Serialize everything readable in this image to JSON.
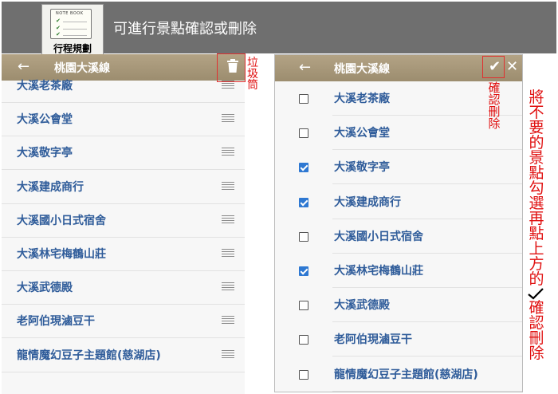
{
  "banner": {
    "notebook_label": "NOTE BOOK",
    "icon_caption": "行程規劃",
    "title": "可進行景點確認或刪除"
  },
  "left_panel": {
    "back_icon": "arrow-left-icon",
    "title": "桃園大溪線",
    "trash_icon": "trash-icon",
    "items": [
      {
        "label": "大溪老茶廠"
      },
      {
        "label": "大溪公會堂"
      },
      {
        "label": "大溪敬字亭"
      },
      {
        "label": "大溪建成商行"
      },
      {
        "label": "大溪國小日式宿舍"
      },
      {
        "label": "大溪林宅梅鶴山莊"
      },
      {
        "label": "大溪武德殿"
      },
      {
        "label": "老阿伯現滷豆干"
      },
      {
        "label": "龍情魔幻豆子主題館(慈湖店)"
      }
    ]
  },
  "right_panel": {
    "back_icon": "arrow-left-icon",
    "title": "桃園大溪線",
    "confirm_icon": "check-icon",
    "close_icon": "close-icon",
    "items": [
      {
        "label": "大溪老茶廠",
        "checked": false
      },
      {
        "label": "大溪公會堂",
        "checked": false
      },
      {
        "label": "大溪敬字亭",
        "checked": true
      },
      {
        "label": "大溪建成商行",
        "checked": true
      },
      {
        "label": "大溪國小日式宿舍",
        "checked": false
      },
      {
        "label": "大溪林宅梅鶴山莊",
        "checked": true
      },
      {
        "label": "大溪武德殿",
        "checked": false
      },
      {
        "label": "老阿伯現滷豆干",
        "checked": false
      },
      {
        "label": "龍情魔幻豆子主題館(慈湖店)",
        "checked": false
      }
    ]
  },
  "annotations": {
    "trash_note": "垃圾筒",
    "confirm_note": "確認刪除",
    "side_note_1": "將不要的景點勾選",
    "side_note_2": "再點上方的",
    "side_note_3": "確認刪除"
  },
  "colors": {
    "appbar": "#a89878",
    "item_text": "#2f5c9a",
    "annotation": "#e01010",
    "checkbox_on": "#2e78d2"
  }
}
